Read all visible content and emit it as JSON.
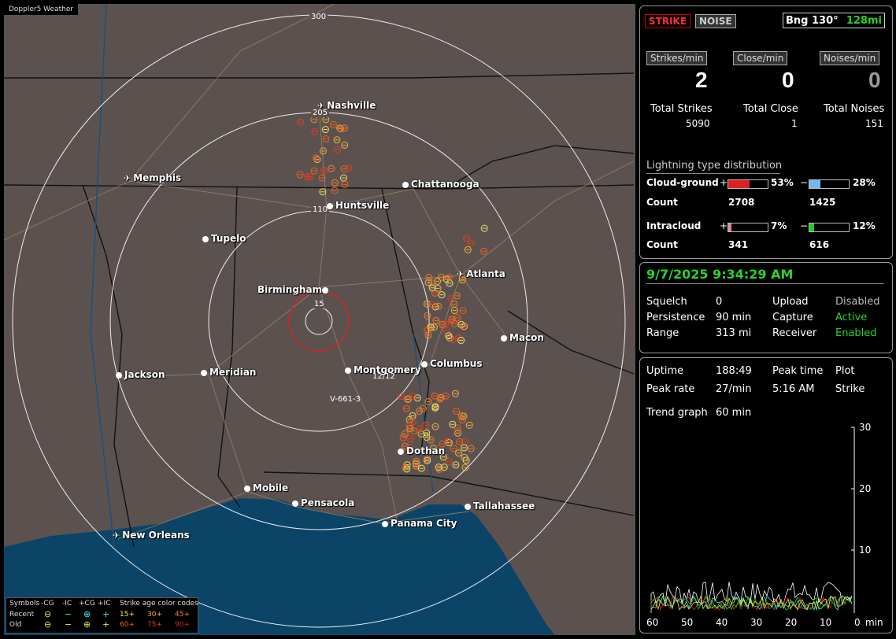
{
  "app": {
    "title": "Doppler5 Weather"
  },
  "map": {
    "ring_labels": [
      "300",
      "205",
      "110",
      "15"
    ],
    "cities": [
      {
        "name": "Nashville",
        "airport": true
      },
      {
        "name": "Memphis",
        "airport": true
      },
      {
        "name": "Chattanooga",
        "airport": false
      },
      {
        "name": "Huntsville",
        "airport": false
      },
      {
        "name": "Tupelo",
        "airport": false
      },
      {
        "name": "Atlanta",
        "airport": true
      },
      {
        "name": "Birmingham",
        "airport": false
      },
      {
        "name": "Macon",
        "airport": false
      },
      {
        "name": "Jackson",
        "airport": false
      },
      {
        "name": "Meridian",
        "airport": false
      },
      {
        "name": "Montgomery",
        "airport": false
      },
      {
        "name": "Columbus",
        "airport": false
      },
      {
        "name": "Dothan",
        "airport": false
      },
      {
        "name": "Mobile",
        "airport": false
      },
      {
        "name": "Pensacola",
        "airport": false
      },
      {
        "name": "Tallahassee",
        "airport": false
      },
      {
        "name": "Panama City",
        "airport": false
      },
      {
        "name": "New Orleans",
        "airport": true
      }
    ],
    "cursor_text": "12/12",
    "vector_text": "V-661-3",
    "legend": {
      "symbols_label": "Symbols",
      "cols": [
        "-CG",
        "-IC",
        "+CG",
        "+IC"
      ],
      "age_label": "Strike age color codes",
      "recent_label": "Recent",
      "old_label": "Old",
      "recent_symbols": [
        "⊖",
        "−",
        "⊕",
        "+"
      ],
      "old_symbols": [
        "⊖",
        "−",
        "⊕",
        "+"
      ],
      "recent_ages": [
        "15+",
        "30+",
        "45+"
      ],
      "old_ages": [
        "60+",
        "75+",
        "90+"
      ]
    }
  },
  "top_panel": {
    "strike_btn": "STRIKE",
    "noise_btn": "NOISE",
    "bearing_label": "Bng 130°",
    "bearing_dist": "128mi",
    "rate_headers": [
      "Strikes/min",
      "Close/min",
      "Noises/min"
    ],
    "rate_values": [
      "2",
      "0",
      "0"
    ],
    "total_labels": [
      "Total Strikes",
      "Total Close",
      "Total Noises"
    ],
    "total_values": [
      "5090",
      "1",
      "151"
    ],
    "dist_title": "Lightning type distribution",
    "cg_label": "Cloud-ground",
    "cg_pos_pct": "53%",
    "cg_neg_pct": "28%",
    "cg_count_label": "Count",
    "cg_pos_count": "2708",
    "cg_neg_count": "1425",
    "ic_label": "Intracloud",
    "ic_pos_pct": "7%",
    "ic_neg_pct": "12%",
    "ic_count_label": "Count",
    "ic_pos_count": "341",
    "ic_neg_count": "616",
    "plus": "+",
    "minus": "−"
  },
  "status_panel": {
    "datetime": "9/7/2025 9:34:29 AM",
    "rows": [
      [
        "Squelch",
        "0",
        "Upload",
        "Disabled"
      ],
      [
        "Persistence",
        "90 min",
        "Capture",
        "Active"
      ],
      [
        "Range",
        "313 mi",
        "Receiver",
        "Enabled"
      ]
    ]
  },
  "stats_panel": {
    "uptime_label": "Uptime",
    "uptime": "188:49",
    "peak_time_label": "Peak time",
    "plot_label": "Plot",
    "peak_rate_label": "Peak rate",
    "peak_rate": "27/min",
    "peak_time": "5:16 AM",
    "plot_value": "Strike",
    "trend_label": "Trend graph",
    "trend_value": "60 min",
    "y_ticks": [
      "30",
      "20",
      "10"
    ],
    "x_ticks": [
      "60",
      "50",
      "40",
      "30",
      "20",
      "10",
      "0"
    ],
    "x_unit": "min"
  },
  "colors": {
    "accent_green": "#2cd12c",
    "strike_red": "#e02020",
    "ic_pos": "#e080b0",
    "cg_neg": "#70b8f0",
    "ic_neg": "#22cc22"
  }
}
